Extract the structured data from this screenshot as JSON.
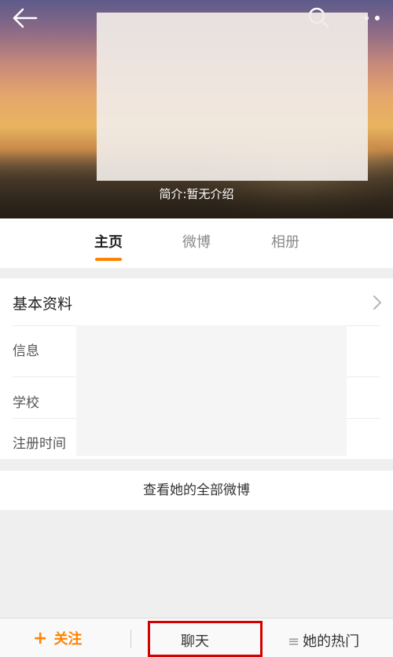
{
  "header": {
    "intro": "简介:暂无介绍",
    "icons": {
      "back": "back-arrow-icon",
      "search": "search-icon",
      "more": "more-dots-icon"
    }
  },
  "tabs": [
    {
      "label": "主页",
      "active": true
    },
    {
      "label": "微博",
      "active": false
    },
    {
      "label": "相册",
      "active": false
    }
  ],
  "profile": {
    "section_title": "基本资料",
    "rows": [
      {
        "label": "信息"
      },
      {
        "label": "学校"
      },
      {
        "label": "注册时间"
      }
    ]
  },
  "all_posts_label": "查看她的全部微博",
  "bottom_bar": {
    "follow_label": "关注",
    "chat_label": "聊天",
    "hot_label": "她的热门"
  },
  "colors": {
    "accent": "#ff8200",
    "highlight": "#d40000"
  }
}
